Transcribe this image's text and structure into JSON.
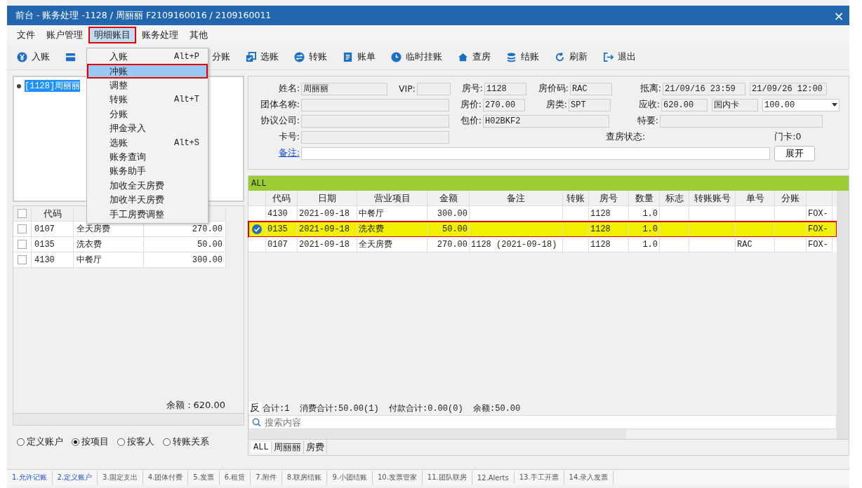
{
  "window": {
    "title": "前台 - 账务处理 -1128 / 周丽丽 F2109160016 / 2109160011",
    "close": "×"
  },
  "menubar": [
    {
      "label": "文件",
      "selected": false,
      "outlined": false
    },
    {
      "label": "账户管理",
      "selected": false,
      "outlined": false
    },
    {
      "label": "明细账目",
      "selected": true,
      "outlined": true
    },
    {
      "label": "账务处理",
      "selected": false,
      "outlined": false
    },
    {
      "label": "其他",
      "selected": false,
      "outlined": false
    }
  ],
  "toolbar": [
    {
      "kind": "button",
      "label": "入账"
    },
    {
      "kind": "covered"
    },
    {
      "kind": "button",
      "label": "分账"
    },
    {
      "kind": "button",
      "label": "选账"
    },
    {
      "kind": "button",
      "label": "转账"
    },
    {
      "kind": "button",
      "label": "账单"
    },
    {
      "kind": "button",
      "label": "临时挂账"
    },
    {
      "kind": "button",
      "label": "查房"
    },
    {
      "kind": "button",
      "label": "结账"
    },
    {
      "kind": "button",
      "label": "刷新"
    },
    {
      "kind": "button",
      "label": "退出"
    }
  ],
  "dropdown": [
    {
      "label": "入账",
      "shortcut": "Alt+P",
      "selected": false,
      "outlined": false
    },
    {
      "label": "冲账",
      "selected": true,
      "outlined": true
    },
    {
      "label": "调整",
      "selected": false,
      "outlined": false
    },
    {
      "label": "转账",
      "shortcut": "Alt+T",
      "selected": false,
      "outlined": false
    },
    {
      "label": "分账",
      "selected": false,
      "outlined": false
    },
    {
      "label": "押金录入",
      "selected": false,
      "outlined": false
    },
    {
      "label": "选账",
      "shortcut": "Alt+S",
      "selected": false,
      "outlined": false
    },
    {
      "label": "账务查询",
      "selected": false,
      "outlined": false
    },
    {
      "label": "账务助手",
      "selected": false,
      "outlined": false
    },
    {
      "label": "加收全天房费",
      "selected": false,
      "outlined": false
    },
    {
      "label": "加收半天房费",
      "selected": false,
      "outlined": false
    },
    {
      "label": "手工房费调整",
      "selected": false,
      "outlined": false
    }
  ],
  "tree": [
    {
      "label": "[1128]周丽丽",
      "selected": true
    }
  ],
  "left_table": {
    "header_checked": false,
    "columns": [
      "代码"
    ],
    "rows": [
      {
        "checked": false,
        "cells": [
          "0107",
          "全天房费",
          "270.00"
        ]
      },
      {
        "checked": false,
        "cells": [
          "0135",
          "洗衣费",
          "50.00"
        ]
      },
      {
        "checked": false,
        "cells": [
          "4130",
          "中餐厅",
          "300.00"
        ]
      }
    ],
    "balance": "余额：620.00"
  },
  "view_options": [
    {
      "label": "定义账户",
      "selected": false
    },
    {
      "label": "按项目",
      "selected": true
    },
    {
      "label": "按客人",
      "selected": false
    },
    {
      "label": "转账关系",
      "selected": false
    }
  ],
  "info": {
    "name_label": "姓名:",
    "name": "周丽丽",
    "vip_label": "VIP:",
    "room_label": "房号:",
    "room": "1128",
    "rate_code_label": "房价码:",
    "rate_code": "RAC",
    "arrive_label": "抵离:",
    "arrive": "21/09/16 23:59",
    "depart": "21/09/26 12:00",
    "group_label": "团体名称:",
    "price_label": "房价:",
    "price": "270.00",
    "room_type_label": "房类:",
    "room_type": "SPT",
    "receivable_label": "应收:",
    "receivable": "620.00",
    "card_type": "国内卡",
    "card_amount": "100.00",
    "company_label": "协议公司:",
    "package_label": "包价:",
    "package": "H02BKF2",
    "special_label": "特要:",
    "card_no_label": "卡号:",
    "checkroom_label": "查房状态:",
    "door_card": "门卡:0",
    "remark_link": "备注:",
    "expand_button": "展开"
  },
  "grid": {
    "group": "ALL",
    "columns": [
      "代码",
      "日期",
      "营业项目",
      "金额",
      "备注",
      "转账",
      "房号",
      "数量",
      "标志",
      "转账账号",
      "单号",
      "分账"
    ],
    "rows": [
      {
        "selected": false,
        "outlined": false,
        "cells": [
          "4130",
          "2021-09-18",
          "中餐厅",
          "300.00",
          "",
          "",
          "1128",
          "1.0",
          "",
          "",
          "",
          "",
          "FOX-"
        ]
      },
      {
        "selected": true,
        "outlined": true,
        "cells": [
          "0135",
          "2021-09-18",
          "洗衣费",
          "50.00",
          "",
          "",
          "1128",
          "1.0",
          "",
          "",
          "",
          "",
          "FOX-"
        ]
      },
      {
        "selected": false,
        "outlined": false,
        "cells": [
          "0107",
          "2021-09-18",
          "全天房费",
          "270.00",
          "1128 (2021-09-18)",
          "",
          "1128",
          "1.0",
          "",
          "",
          "RAC",
          "",
          "FOX-"
        ]
      }
    ],
    "reverse": "反",
    "summary": "合计:1  消费合计:50.00(1)  付款合计:0.00(0)  余额:50.00",
    "search_placeholder": "搜索内容"
  },
  "guest_tabs": [
    {
      "label": "ALL",
      "selected": true
    },
    {
      "label": "周丽丽",
      "selected": false
    },
    {
      "label": "房费",
      "selected": false
    }
  ],
  "bottom_tabs": [
    {
      "label": "1.允许记账",
      "highlighted": true
    },
    {
      "label": "2.定义账户",
      "highlighted": true
    },
    {
      "label": "3.固定支出",
      "highlighted": false
    },
    {
      "label": "4.团体付费",
      "highlighted": false
    },
    {
      "label": "5.发票",
      "highlighted": false
    },
    {
      "label": "6.租赁",
      "highlighted": false
    },
    {
      "label": "7.附件",
      "highlighted": false
    },
    {
      "label": "8.联房结账",
      "highlighted": false
    },
    {
      "label": "9.小团结账",
      "highlighted": false
    },
    {
      "label": "10.发票管家",
      "highlighted": false
    },
    {
      "label": "11.团队联房",
      "highlighted": false
    },
    {
      "label": "12.Alerts",
      "highlighted": false
    },
    {
      "label": "13.手工开票",
      "highlighted": false
    },
    {
      "label": "14.录入发票",
      "highlighted": false
    }
  ]
}
